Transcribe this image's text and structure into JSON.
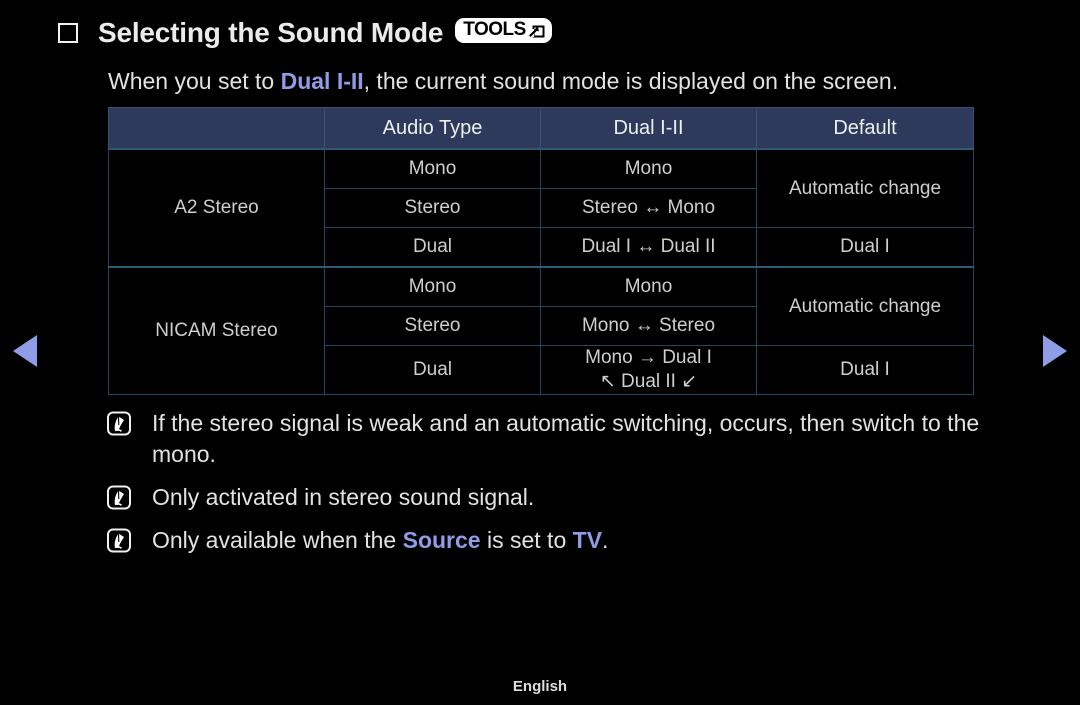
{
  "page": {
    "title": "Selecting the Sound Mode",
    "tools_badge_label": "TOOLS",
    "bullet_icon": "square-bullet-icon",
    "tools_icon": "tools-arrow-icon",
    "footer_language": "English",
    "accent_color": "#8f9ce6",
    "header_bg_color": "#2e3a5c",
    "background_color": "#000000"
  },
  "intro": {
    "before": "When you set to ",
    "highlight": "Dual I-II",
    "after": ", the current sound mode is displayed on the screen."
  },
  "table": {
    "headers": [
      "",
      "Audio Type",
      "Dual I-II",
      "Default"
    ],
    "header_accent_index": 2,
    "groups": [
      {
        "name": "A2 Stereo",
        "rows": [
          {
            "audio_type": "Mono",
            "dual": "Mono",
            "default": "Automatic change",
            "default_rowspan": 2,
            "default_accent": false
          },
          {
            "audio_type": "Stereo",
            "dual": "Stereo ↔ Mono"
          },
          {
            "audio_type": "Dual",
            "dual": "Dual I ↔ Dual II",
            "default": "Dual I",
            "default_rowspan": 1,
            "default_accent": true
          }
        ]
      },
      {
        "name": "NICAM Stereo",
        "rows": [
          {
            "audio_type": "Mono",
            "dual": "Mono",
            "default": "Automatic change",
            "default_rowspan": 2,
            "default_accent": false
          },
          {
            "audio_type": "Stereo",
            "dual": "Mono ↔ Stereo"
          },
          {
            "audio_type": "Dual",
            "dual_line1": "Mono → Dual I",
            "dual_line2": "↖ Dual II ↙",
            "default": "Dual I",
            "default_rowspan": 1,
            "default_accent": true
          }
        ]
      }
    ]
  },
  "notes": [
    {
      "icon": "note-pen-icon",
      "segments": [
        {
          "text": "If the stereo signal is weak and an automatic switching, occurs, then switch to the mono.",
          "accent": false
        }
      ]
    },
    {
      "icon": "note-pen-icon",
      "segments": [
        {
          "text": "Only activated in stereo sound signal.",
          "accent": false
        }
      ]
    },
    {
      "icon": "note-pen-icon",
      "segments": [
        {
          "text": "Only available when the ",
          "accent": false
        },
        {
          "text": "Source",
          "accent": true
        },
        {
          "text": " is set to ",
          "accent": false
        },
        {
          "text": "TV",
          "accent": true
        },
        {
          "text": ".",
          "accent": false
        }
      ]
    }
  ],
  "nav": {
    "prev_label": "previous-page",
    "next_label": "next-page"
  }
}
